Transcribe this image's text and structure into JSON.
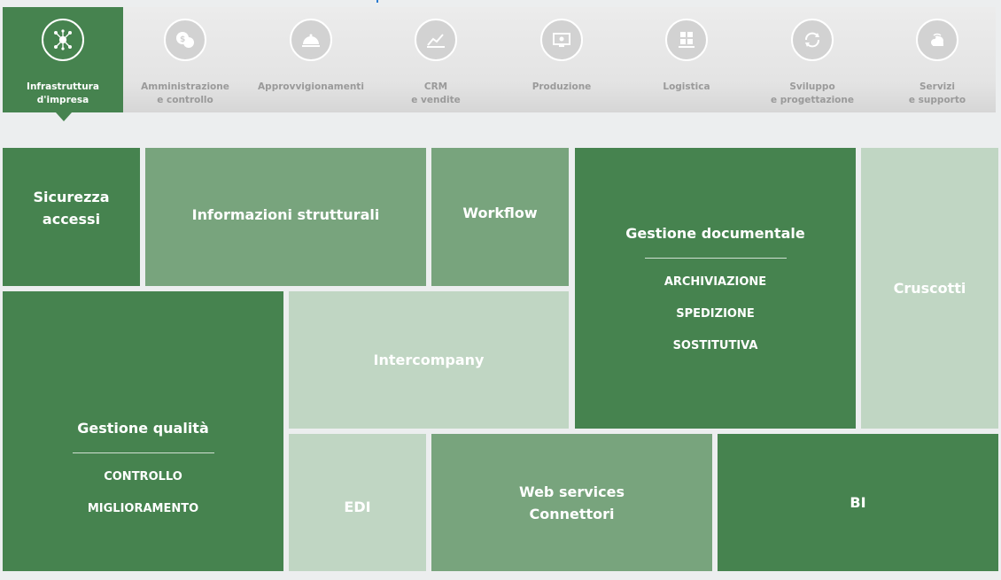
{
  "nav": {
    "tabs": [
      {
        "id": "infrastruttura",
        "label": "Infrastruttura\nd'impresa",
        "icon": "network-icon",
        "active": true
      },
      {
        "id": "amministrazione",
        "label": "Amministrazione\ne controllo",
        "icon": "coins-icon",
        "active": false
      },
      {
        "id": "approvvigionamenti",
        "label": "Approvvigionamenti",
        "icon": "cloche-icon",
        "active": false
      },
      {
        "id": "crm",
        "label": "CRM\ne vendite",
        "icon": "chart-icon",
        "active": false
      },
      {
        "id": "produzione",
        "label": "Produzione",
        "icon": "monitor-icon",
        "active": false
      },
      {
        "id": "logistica",
        "label": "Logistica",
        "icon": "boxes-icon",
        "active": false
      },
      {
        "id": "sviluppo",
        "label": "Sviluppo\ne progettazione",
        "icon": "refresh-icon",
        "active": false
      },
      {
        "id": "servizi",
        "label": "Servizi\ne supporto",
        "icon": "cloud-icon",
        "active": false
      }
    ]
  },
  "tiles": {
    "sicurezza": {
      "title": "Sicurezza\naccessi"
    },
    "informazioni": {
      "title": "Informazioni strutturali"
    },
    "workflow": {
      "title": "Workflow"
    },
    "documentale": {
      "title": "Gestione documentale",
      "items": [
        "ARCHIVIAZIONE",
        "SPEDIZIONE",
        "SOSTITUTIVA"
      ]
    },
    "cruscotti": {
      "title": "Cruscotti"
    },
    "qualita": {
      "title": "Gestione qualità",
      "items": [
        "CONTROLLO",
        "MIGLIORAMENTO"
      ]
    },
    "intercompany": {
      "title": "Intercompany"
    },
    "edi": {
      "title": "EDI"
    },
    "webservices": {
      "title": "Web services\nConnettori"
    },
    "bi": {
      "title": "BI"
    }
  },
  "colors": {
    "dark": "#46834f",
    "mid": "#78a47d",
    "light": "#c0d6c3",
    "tab_inactive": "#9a9a9a"
  }
}
